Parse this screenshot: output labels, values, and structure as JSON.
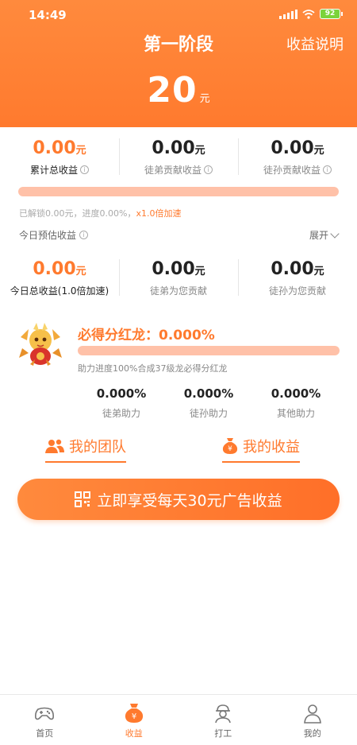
{
  "status": {
    "time": "14:49",
    "battery": "92"
  },
  "header": {
    "title": "第一阶段",
    "explain": "收益说明",
    "amount": "20",
    "unit": "元"
  },
  "totals": [
    {
      "value": "0.00",
      "unit": "元",
      "label": "累计总收益"
    },
    {
      "value": "0.00",
      "unit": "元",
      "label": "徒弟贡献收益"
    },
    {
      "value": "0.00",
      "unit": "元",
      "label": "徒孙贡献收益"
    }
  ],
  "progress_main": {
    "fraction": 0.0
  },
  "unlock": {
    "prefix": "已解锁0.00元，进度0.00%，",
    "speed": "x1.0倍加速"
  },
  "today": {
    "label": "今日预估收益",
    "expand": "展开"
  },
  "today_stats": [
    {
      "value": "0.00",
      "unit": "元",
      "label": "今日总收益(1.0倍加速)"
    },
    {
      "value": "0.00",
      "unit": "元",
      "label": "徒弟为您贡献"
    },
    {
      "value": "0.00",
      "unit": "元",
      "label": "徒孙为您贡献"
    }
  ],
  "dragon": {
    "title": "必得分红龙：0.000%",
    "progress": 0.0,
    "note": "助力进度100%合成37级龙必得分红龙",
    "helpers": [
      {
        "value": "0.000%",
        "label": "徒弟助力"
      },
      {
        "value": "0.000%",
        "label": "徒孙助力"
      },
      {
        "value": "0.000%",
        "label": "其他助力"
      }
    ]
  },
  "links": {
    "team": "我的团队",
    "earnings": "我的收益"
  },
  "cta": {
    "label": "立即享受每天30元广告收益"
  },
  "tabs": [
    {
      "label": "首页",
      "icon": "gamepad-icon"
    },
    {
      "label": "收益",
      "icon": "money-bag-icon"
    },
    {
      "label": "打工",
      "icon": "worker-icon"
    },
    {
      "label": "我的",
      "icon": "person-icon"
    }
  ],
  "colors": {
    "accent": "#ff7a2e",
    "progress_track": "#ffc1a8"
  }
}
